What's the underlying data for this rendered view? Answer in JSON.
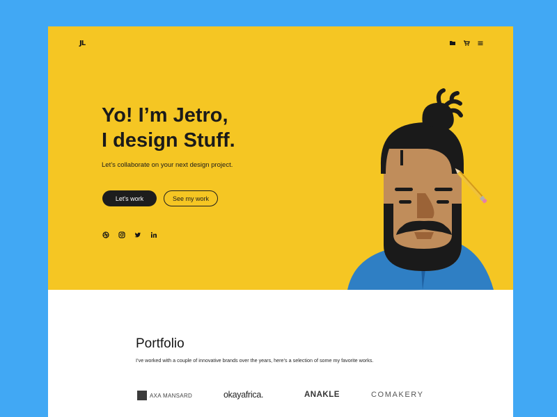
{
  "brand": {
    "logo_text": "JL"
  },
  "nav": {
    "icons": [
      "folder-icon",
      "cart-icon",
      "menu-icon"
    ]
  },
  "hero": {
    "headline_line1": "Yo! I’m Jetro,",
    "headline_line2": "I design Stuff.",
    "subtitle": "Let’s collaborate  on your next design project.",
    "primary_button": "Let's work",
    "secondary_button": "See my work",
    "social_icons": [
      "dribbble-icon",
      "instagram-icon",
      "twitter-icon",
      "linkedin-icon"
    ],
    "background_color": "#f5c623"
  },
  "portfolio": {
    "title": "Portfolio",
    "description": "I’ve worked with a couple of innovative brands over the years, here’s a selection of some my favorite works.",
    "brands": [
      "AXA MANSARD",
      "okayafrica.",
      "ANAKLE",
      "COMAKERY"
    ]
  },
  "colors": {
    "frame_background": "#41a8f4",
    "hero_yellow": "#f5c623",
    "text_dark": "#1a1a1a",
    "shirt_blue": "#2f7fc4"
  }
}
